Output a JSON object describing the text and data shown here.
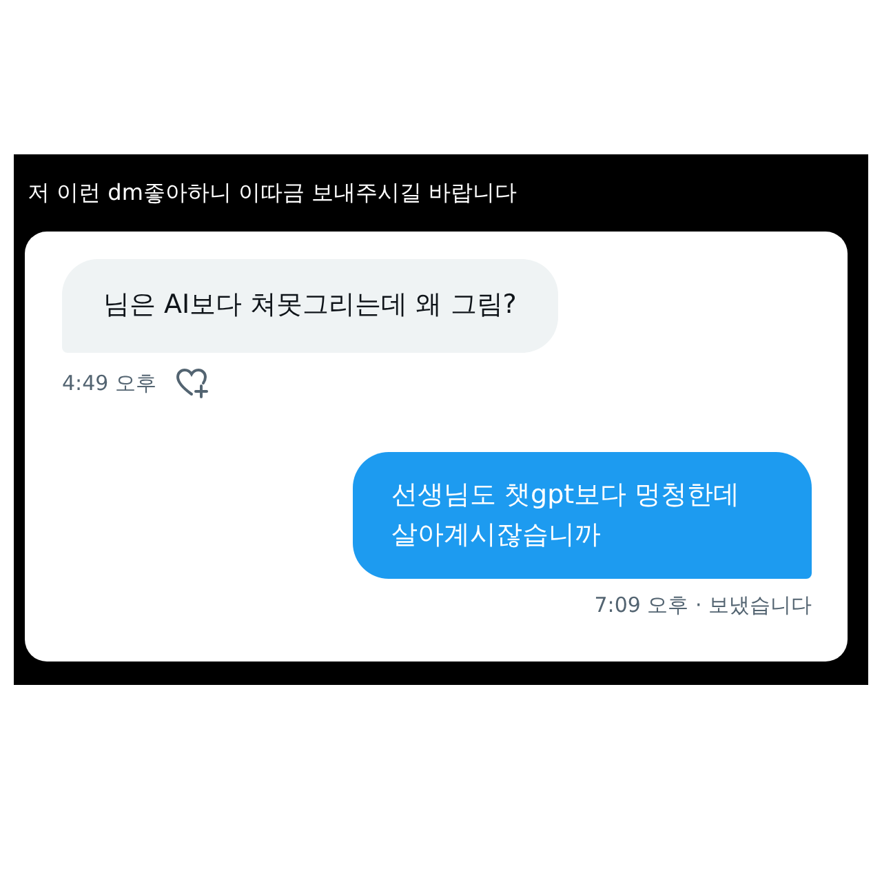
{
  "caption": "저 이런 dm좋아하니 이따금 보내주시길 바랍니다",
  "messages": [
    {
      "kind": "received",
      "text": "님은 AI보다 쳐못그리는데 왜 그림?",
      "meta": "4:49 오후"
    },
    {
      "kind": "sent",
      "text": "선생님도 챗gpt보다 멍청한데 살아계시잖습니까",
      "meta": "7:09 오후 · 보냈습니다"
    }
  ]
}
